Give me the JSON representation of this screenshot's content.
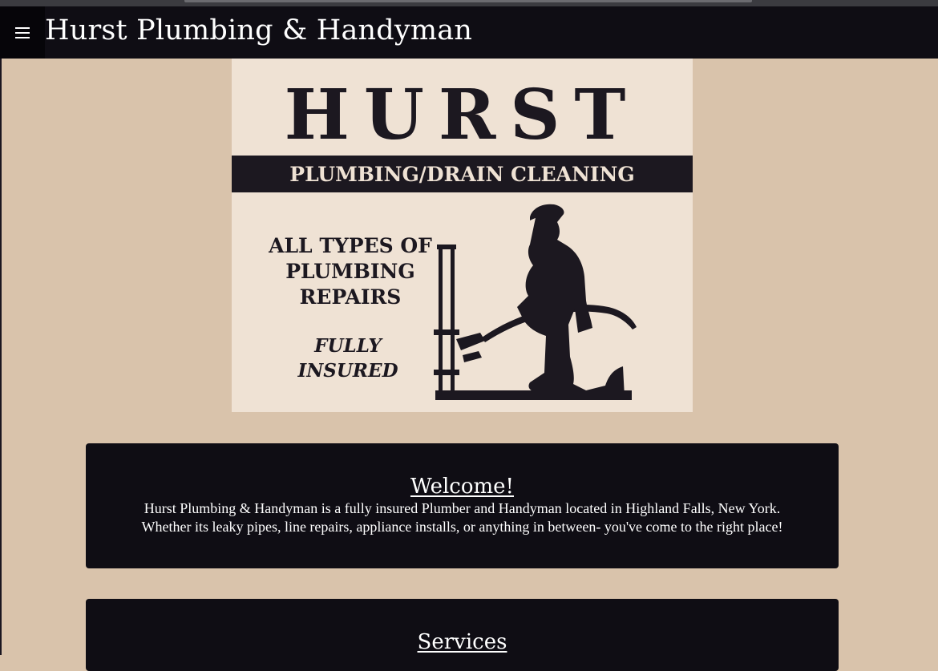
{
  "header": {
    "title": "Hurst Plumbing & Handyman",
    "menu_icon": "hamburger-menu-icon"
  },
  "logo": {
    "brand": "HURST",
    "band": "PLUMBING/DRAIN CLEANING",
    "repairs_lines": [
      "ALL TYPES OF",
      "PLUMBING",
      "REPAIRS"
    ],
    "insured_lines": [
      "FULLY",
      "INSURED"
    ]
  },
  "welcome": {
    "heading": "Welcome!",
    "line1": "Hurst Plumbing & Handyman is a fully insured Plumber and Handyman located in Highland Falls, New York.",
    "line2": "Whether its leaky pipes, line repairs, appliance installs, or anything in between- you've come to the right place!"
  },
  "services": {
    "heading": "Services"
  },
  "colors": {
    "page_background": "#d9c3ab",
    "header_background": "#0f0d14",
    "card_background": "#0f0d14",
    "text_on_dark": "#ffffff"
  }
}
